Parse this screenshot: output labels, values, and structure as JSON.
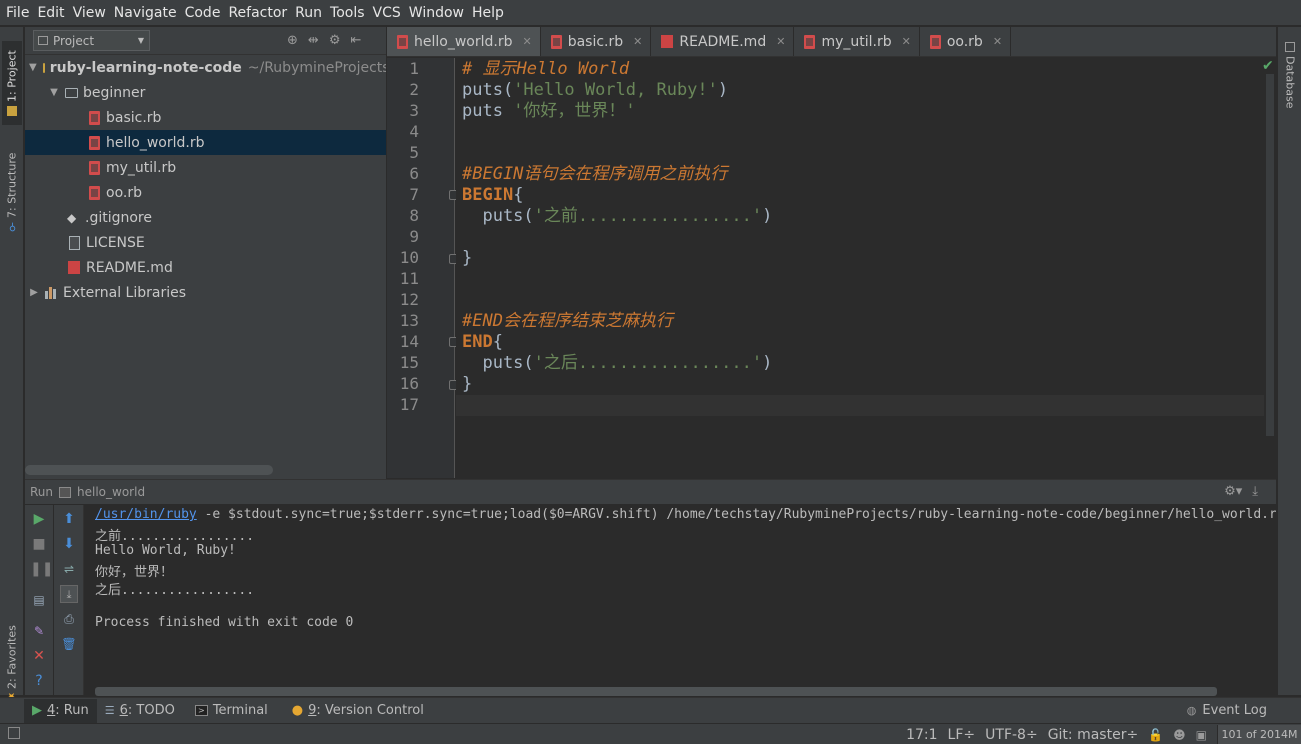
{
  "menu": [
    "File",
    "Edit",
    "View",
    "Navigate",
    "Code",
    "Refactor",
    "Run",
    "Tools",
    "VCS",
    "Window",
    "Help"
  ],
  "left_strip": {
    "project_tab": "1: Project",
    "structure_tab": "7: Structure",
    "favorites_tab": "2: Favorites"
  },
  "right_strip": {
    "database_tab": "Database"
  },
  "project": {
    "view_selector": "Project",
    "root_name": "ruby-learning-note-code",
    "root_path": "~/RubymineProjects",
    "folder": "beginner",
    "files": [
      "basic.rb",
      "hello_world.rb",
      "my_util.rb",
      "oo.rb"
    ],
    "gitignore": ".gitignore",
    "license": "LICENSE",
    "readme": "README.md",
    "external": "External Libraries"
  },
  "tabs": [
    {
      "label": "hello_world.rb"
    },
    {
      "label": "basic.rb"
    },
    {
      "label": "README.md"
    },
    {
      "label": "my_util.rb"
    },
    {
      "label": "oo.rb"
    }
  ],
  "editor": {
    "line_numbers": [
      "1",
      "2",
      "3",
      "4",
      "5",
      "6",
      "7",
      "8",
      "9",
      "10",
      "11",
      "12",
      "13",
      "14",
      "15",
      "16",
      "17"
    ],
    "lines": {
      "l1": "# 显示Hello World",
      "l2a": "puts(",
      "l2b": "'Hello World, Ruby!'",
      "l2c": ")",
      "l3a": "puts ",
      "l3b": "'你好，世界！'",
      "l6": "#BEGIN语句会在程序调用之前执行",
      "l7a": "BEGIN",
      "l7b": "{",
      "l8a": "  puts(",
      "l8b": "'之前.................'",
      "l8c": ")",
      "l10": "}",
      "l13": "#END会在程序结束芝麻执行",
      "l14a": "END",
      "l14b": "{",
      "l15a": "  puts(",
      "l15b": "'之后.................'",
      "l15c": ")",
      "l16": "}"
    }
  },
  "run": {
    "header_label": "Run",
    "config_name": "hello_world",
    "command_link": "/usr/bin/ruby",
    "command_rest": " -e $stdout.sync=true;$stderr.sync=true;load($0=ARGV.shift) /home/techstay/RubymineProjects/ruby-learning-note-code/beginner/hello_world.rb",
    "output": [
      "之前.................",
      "Hello World, Ruby!",
      "你好，世界！",
      "之后.................",
      "",
      "Process finished with exit code 0"
    ]
  },
  "bottom_tools": {
    "run": {
      "num": "4",
      "label": ": Run"
    },
    "todo": {
      "num": "6",
      "label": ": TODO"
    },
    "terminal": "Terminal",
    "vcs": {
      "num": "9",
      "label": ": Version Control"
    },
    "event_log": "Event Log"
  },
  "status": {
    "position": "17:1",
    "line_sep": "LF÷",
    "encoding": "UTF-8÷",
    "git": "Git: master÷",
    "memory": "101 of 2014M"
  },
  "colors": {
    "keyword": "#cc7832",
    "string": "#6a8759",
    "selection": "#0d293e",
    "link": "#5394ec"
  }
}
